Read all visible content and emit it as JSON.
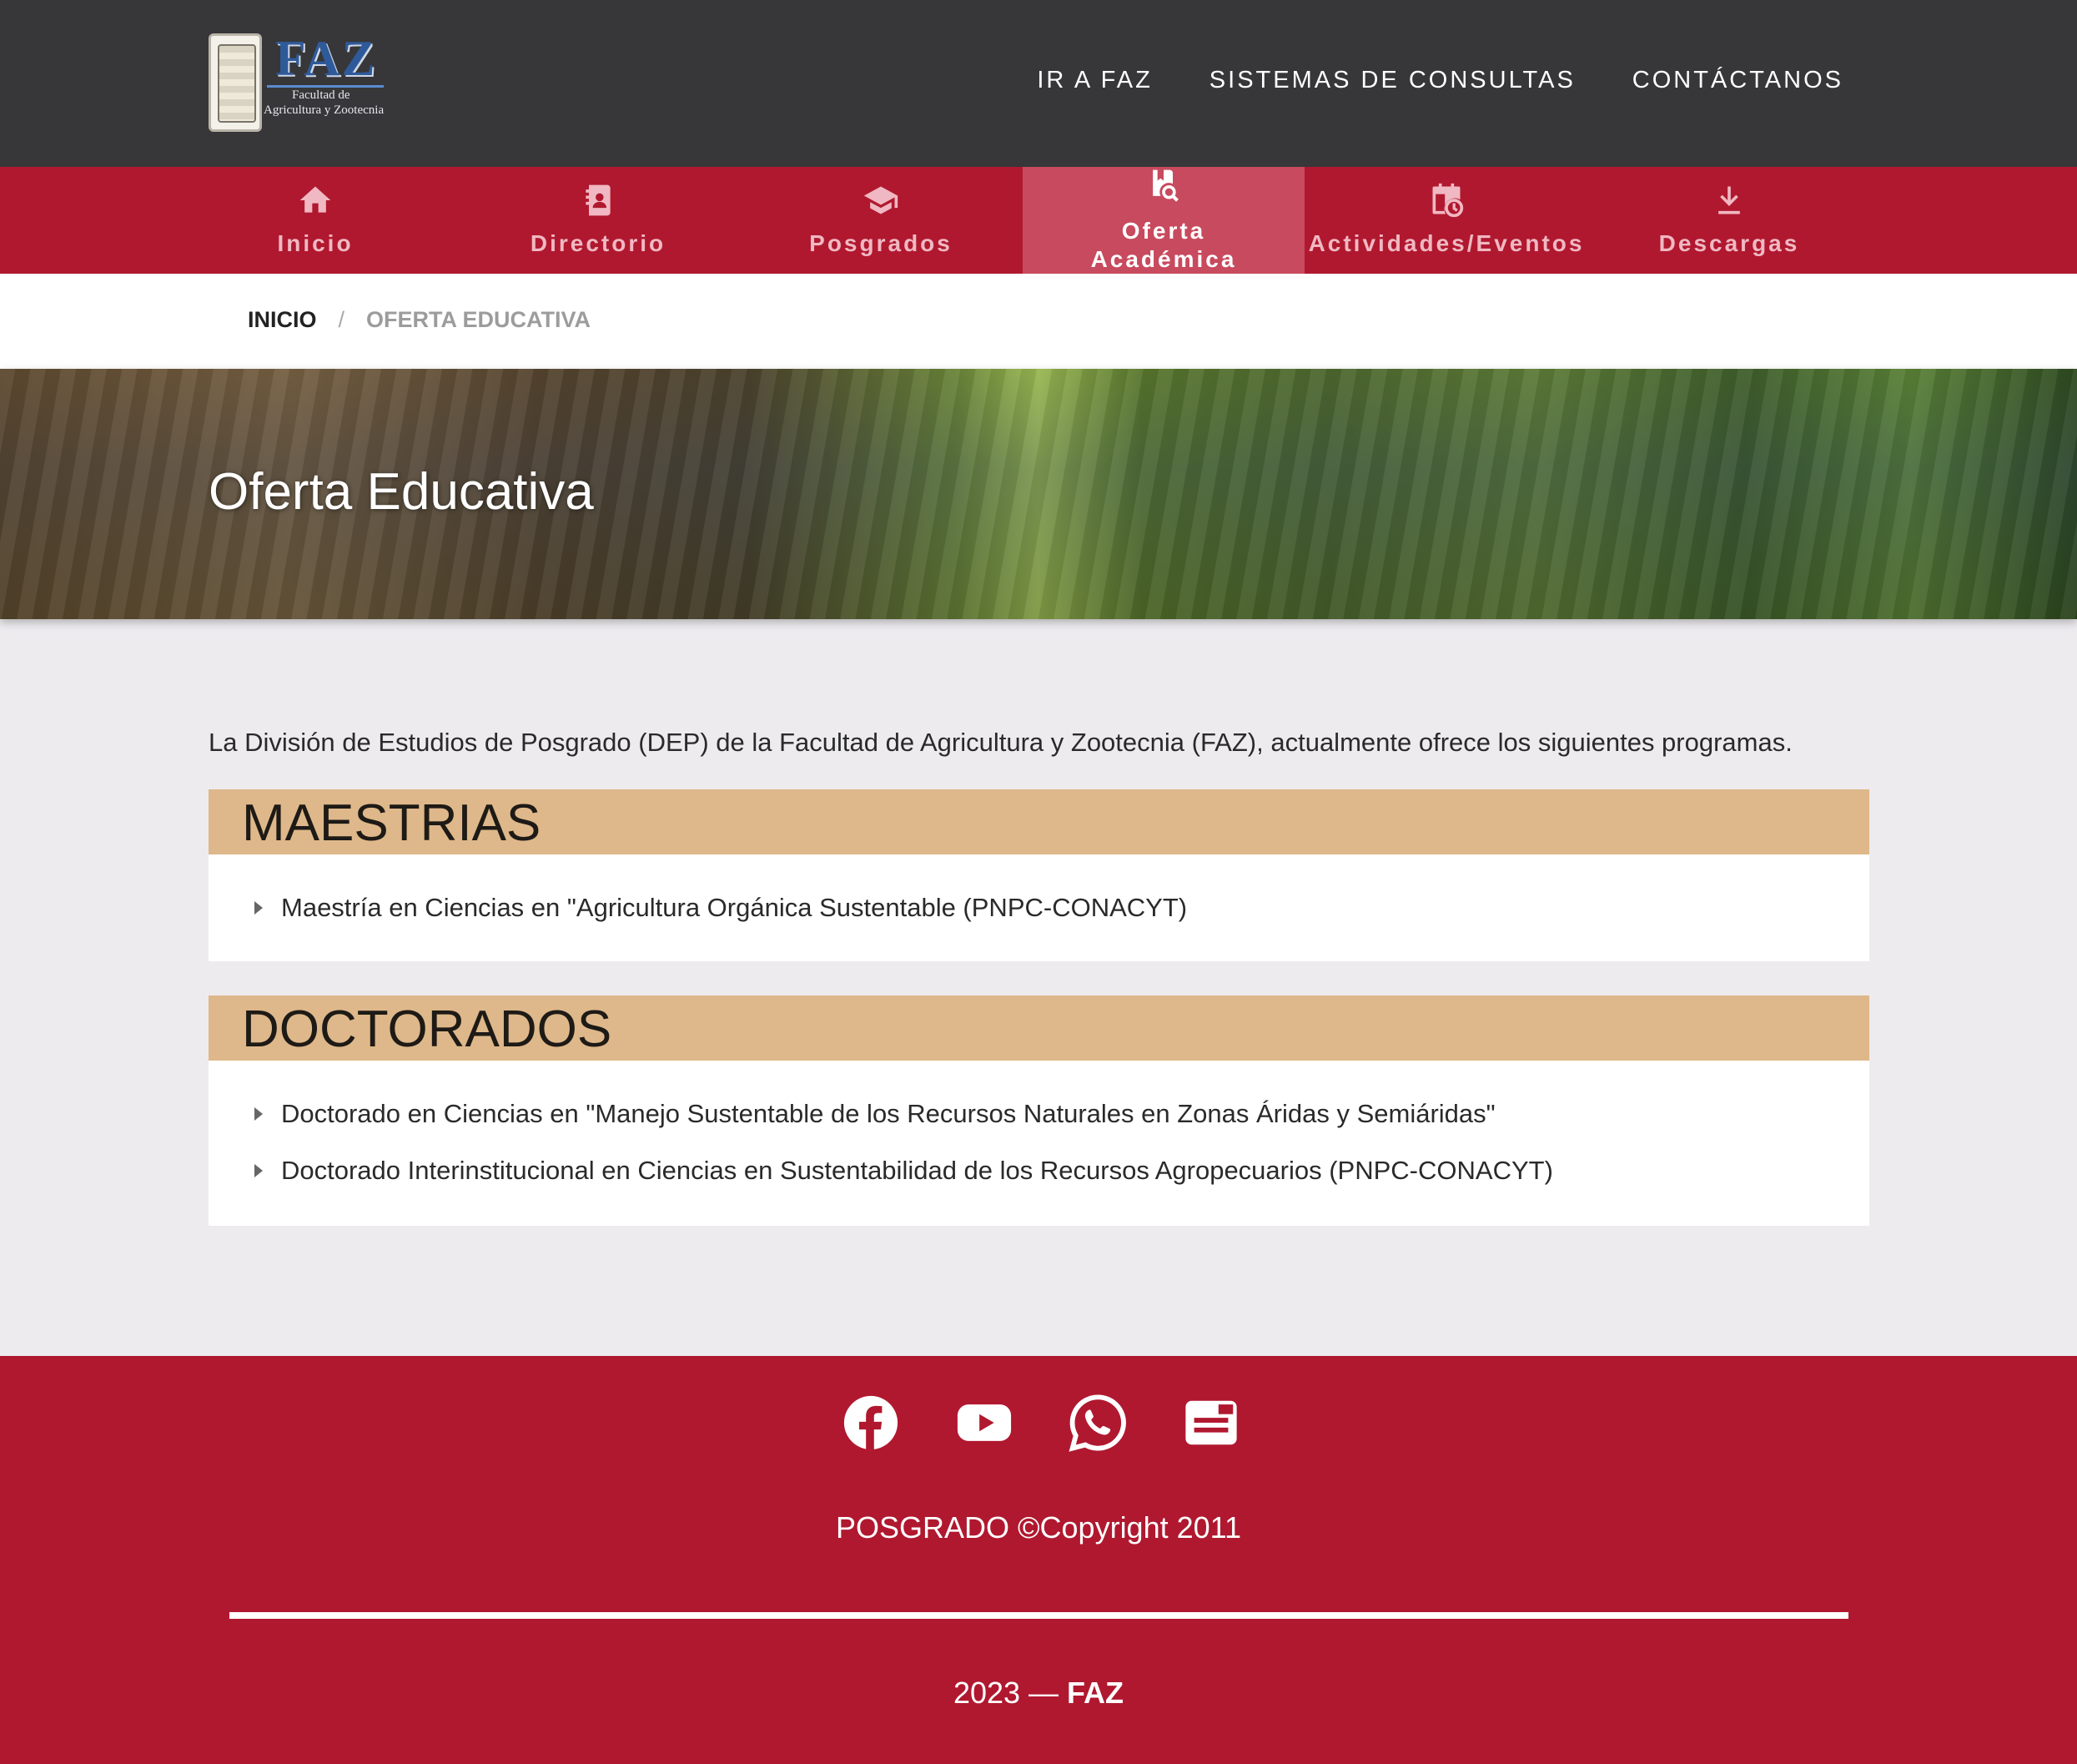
{
  "header": {
    "logo": {
      "title": "FAZ",
      "line1": "Facultad de",
      "line2": "Agricultura y Zootecnia"
    },
    "links": [
      "IR A FAZ",
      "SISTEMAS DE CONSULTAS",
      "CONTÁCTANOS"
    ]
  },
  "nav": {
    "items": [
      {
        "label": "Inicio",
        "icon": "home-icon"
      },
      {
        "label": "Directorio",
        "icon": "contact-book-icon"
      },
      {
        "label": "Posgrados",
        "icon": "graduation-cap-icon"
      },
      {
        "label": "Oferta Académica",
        "line1": "Oferta",
        "line2": "Académica",
        "icon": "book-search-icon",
        "active": true
      },
      {
        "label": "Actividades/Eventos",
        "icon": "calendar-clock-icon"
      },
      {
        "label": "Descargas",
        "icon": "download-icon"
      }
    ]
  },
  "breadcrumb": {
    "home": "INICIO",
    "separator": "/",
    "current": "OFERTA EDUCATIVA"
  },
  "banner": {
    "title": "Oferta Educativa"
  },
  "intro": "La División de Estudios de Posgrado (DEP) de la Facultad de Agricultura y Zootecnia (FAZ), actualmente ofrece los siguientes programas.",
  "sections": [
    {
      "title": "MAESTRIAS",
      "items": [
        "Maestría en Ciencias en \"Agricultura Orgánica Sustentable (PNPC-CONACYT)"
      ]
    },
    {
      "title": "DOCTORADOS",
      "items": [
        "Doctorado en Ciencias en \"Manejo Sustentable de los Recursos Naturales en Zonas Áridas y Semiáridas\"",
        "Doctorado Interinstitucional en Ciencias en Sustentabilidad de los Recursos Agropecuarios (PNPC-CONACYT)"
      ]
    }
  ],
  "footer": {
    "social": [
      "facebook-icon",
      "youtube-icon",
      "whatsapp-icon",
      "news-icon"
    ],
    "copyright": "POSGRADO ©Copyright 2011",
    "year_text": "2023 — ",
    "brand": "FAZ"
  },
  "colors": {
    "header_bg": "#373739",
    "nav_red": "#b0182f",
    "nav_active": "#c84a5e",
    "section_head": "#deb88a",
    "page_bg": "#edebee"
  }
}
